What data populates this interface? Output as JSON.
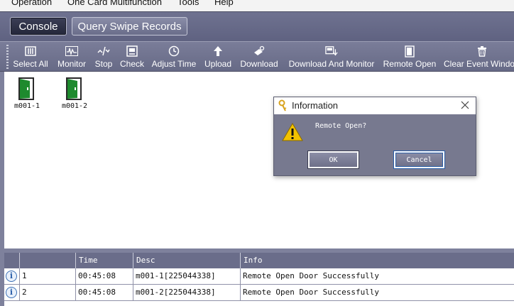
{
  "menubar": {
    "items": [
      "Operation",
      "One Card Multifunction",
      "Tools",
      "Help"
    ]
  },
  "tabs": [
    {
      "label": "Console",
      "active": true
    },
    {
      "label": "Query Swipe Records",
      "active": false
    }
  ],
  "toolbar": {
    "buttons": [
      {
        "label": "Select All",
        "icon": "select-all-icon"
      },
      {
        "label": "Monitor",
        "icon": "monitor-icon"
      },
      {
        "label": "Stop",
        "icon": "stop-icon"
      },
      {
        "label": "Check",
        "icon": "check-icon"
      },
      {
        "label": "Adjust Time",
        "icon": "clock-icon"
      },
      {
        "label": "Upload",
        "icon": "upload-arrow-icon"
      },
      {
        "label": "Download",
        "icon": "download-icon"
      },
      {
        "label": "Download And Monitor",
        "icon": "download-monitor-icon"
      },
      {
        "label": "Remote Open",
        "icon": "remote-open-icon"
      },
      {
        "label": "Clear Event Window",
        "icon": "clear-icon"
      }
    ]
  },
  "devices": [
    {
      "name": "m001-1",
      "icon": "door-open-icon"
    },
    {
      "name": "m001-2",
      "icon": "door-open-icon"
    }
  ],
  "events": {
    "columns": [
      "",
      "Time",
      "Desc",
      "Info"
    ],
    "rows": [
      {
        "index": "1",
        "time": "00:45:08",
        "desc": "m001-1[225044338]",
        "info": "Remote Open Door Successfully"
      },
      {
        "index": "2",
        "time": "00:45:08",
        "desc": "m001-2[225044338]",
        "info": "Remote Open Door Successfully"
      }
    ]
  },
  "dialog": {
    "title": "Information",
    "message": "Remote Open?",
    "ok_label": "OK",
    "cancel_label": "Cancel"
  },
  "colors": {
    "toolbar": "#6f7290",
    "door_green": "#1e8a2e",
    "dialog_body": "#77798f"
  }
}
